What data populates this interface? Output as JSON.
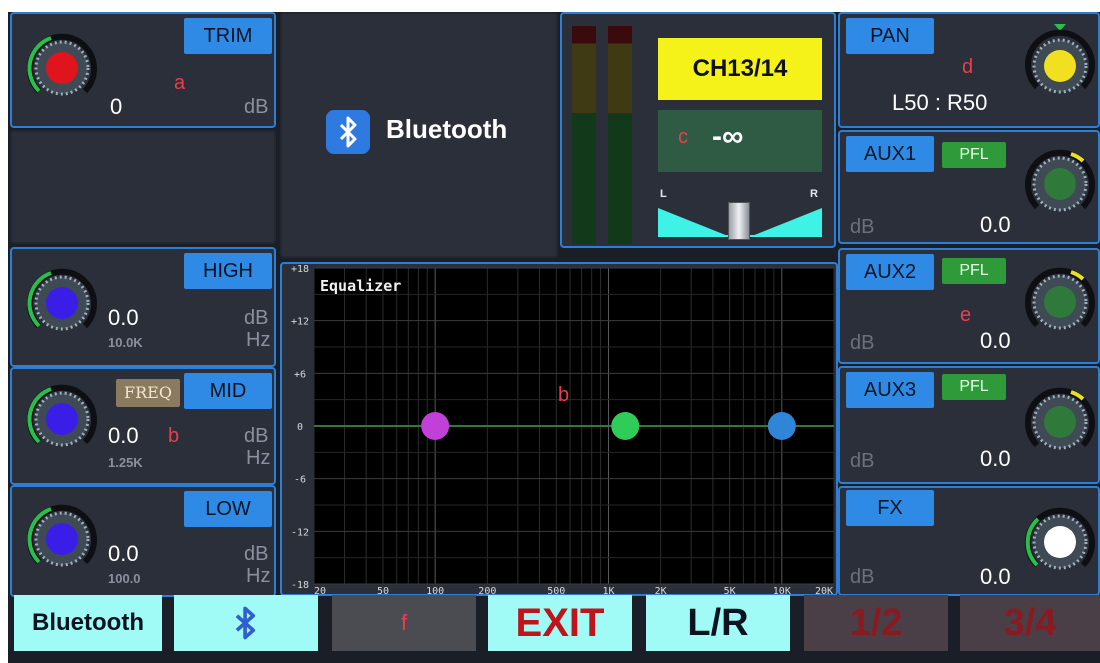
{
  "channel": {
    "name": "CH13/14",
    "level": "-∞",
    "letter": "c"
  },
  "source": {
    "name": "Bluetooth"
  },
  "trim": {
    "label": "TRIM",
    "value": "0",
    "unit": "dB",
    "letter": "a"
  },
  "eq_high": {
    "label": "HIGH",
    "value": "0.0",
    "freq": "10.0K",
    "unit_db": "dB",
    "unit_hz": "Hz"
  },
  "eq_mid": {
    "label": "MID",
    "freq_label": "FREQ",
    "value": "0.0",
    "freq": "1.25K",
    "unit_db": "dB",
    "unit_hz": "Hz",
    "letter": "b"
  },
  "eq_low": {
    "label": "LOW",
    "value": "0.0",
    "freq": "100.0",
    "unit_db": "dB",
    "unit_hz": "Hz"
  },
  "balance": {
    "left": "L",
    "right": "R"
  },
  "pan": {
    "label": "PAN",
    "value": "L50 : R50",
    "letter": "d"
  },
  "aux1": {
    "label": "AUX1",
    "pfl": "PFL",
    "unit": "dB",
    "value": "0.0"
  },
  "aux2": {
    "label": "AUX2",
    "pfl": "PFL",
    "unit": "dB",
    "value": "0.0",
    "letter": "e"
  },
  "aux3": {
    "label": "AUX3",
    "pfl": "PFL",
    "unit": "dB",
    "value": "0.0"
  },
  "fx": {
    "label": "FX",
    "unit": "dB",
    "value": "0.0"
  },
  "equalizer": {
    "title": "Equalizer",
    "letter": "b",
    "y_ticks": [
      "+18",
      "+12",
      "+6",
      "0",
      "-6",
      "-12",
      "-18"
    ],
    "x_ticks": [
      "20",
      "50",
      "100",
      "200",
      "500",
      "1K",
      "2K",
      "5K",
      "10K",
      "20K"
    ],
    "points": [
      {
        "name": "low-band-point",
        "freq": 100,
        "gain": 0,
        "color": "#c040d8"
      },
      {
        "name": "mid-band-point",
        "freq": 1250,
        "gain": 0,
        "color": "#2fcc5a"
      },
      {
        "name": "high-band-point",
        "freq": 10000,
        "gain": 0,
        "color": "#2f86d8"
      }
    ]
  },
  "footer": {
    "bluetooth": "Bluetooth",
    "letter": "f",
    "exit": "EXIT",
    "lr": "L/R",
    "page1": "1/2",
    "page2": "3/4"
  },
  "colors": {
    "accent": "#2f8ae6",
    "panel": "#2b2f3a",
    "pfl": "#2e9a3a",
    "channel_name_bg": "#f5f21a",
    "cyan": "#3ef2e6"
  },
  "knob_colors": {
    "trim": "#e0141c",
    "eq": "#3a1ee8",
    "pan": "#f0e020",
    "aux": "#2f7a3a",
    "fx": "#ffffff"
  }
}
